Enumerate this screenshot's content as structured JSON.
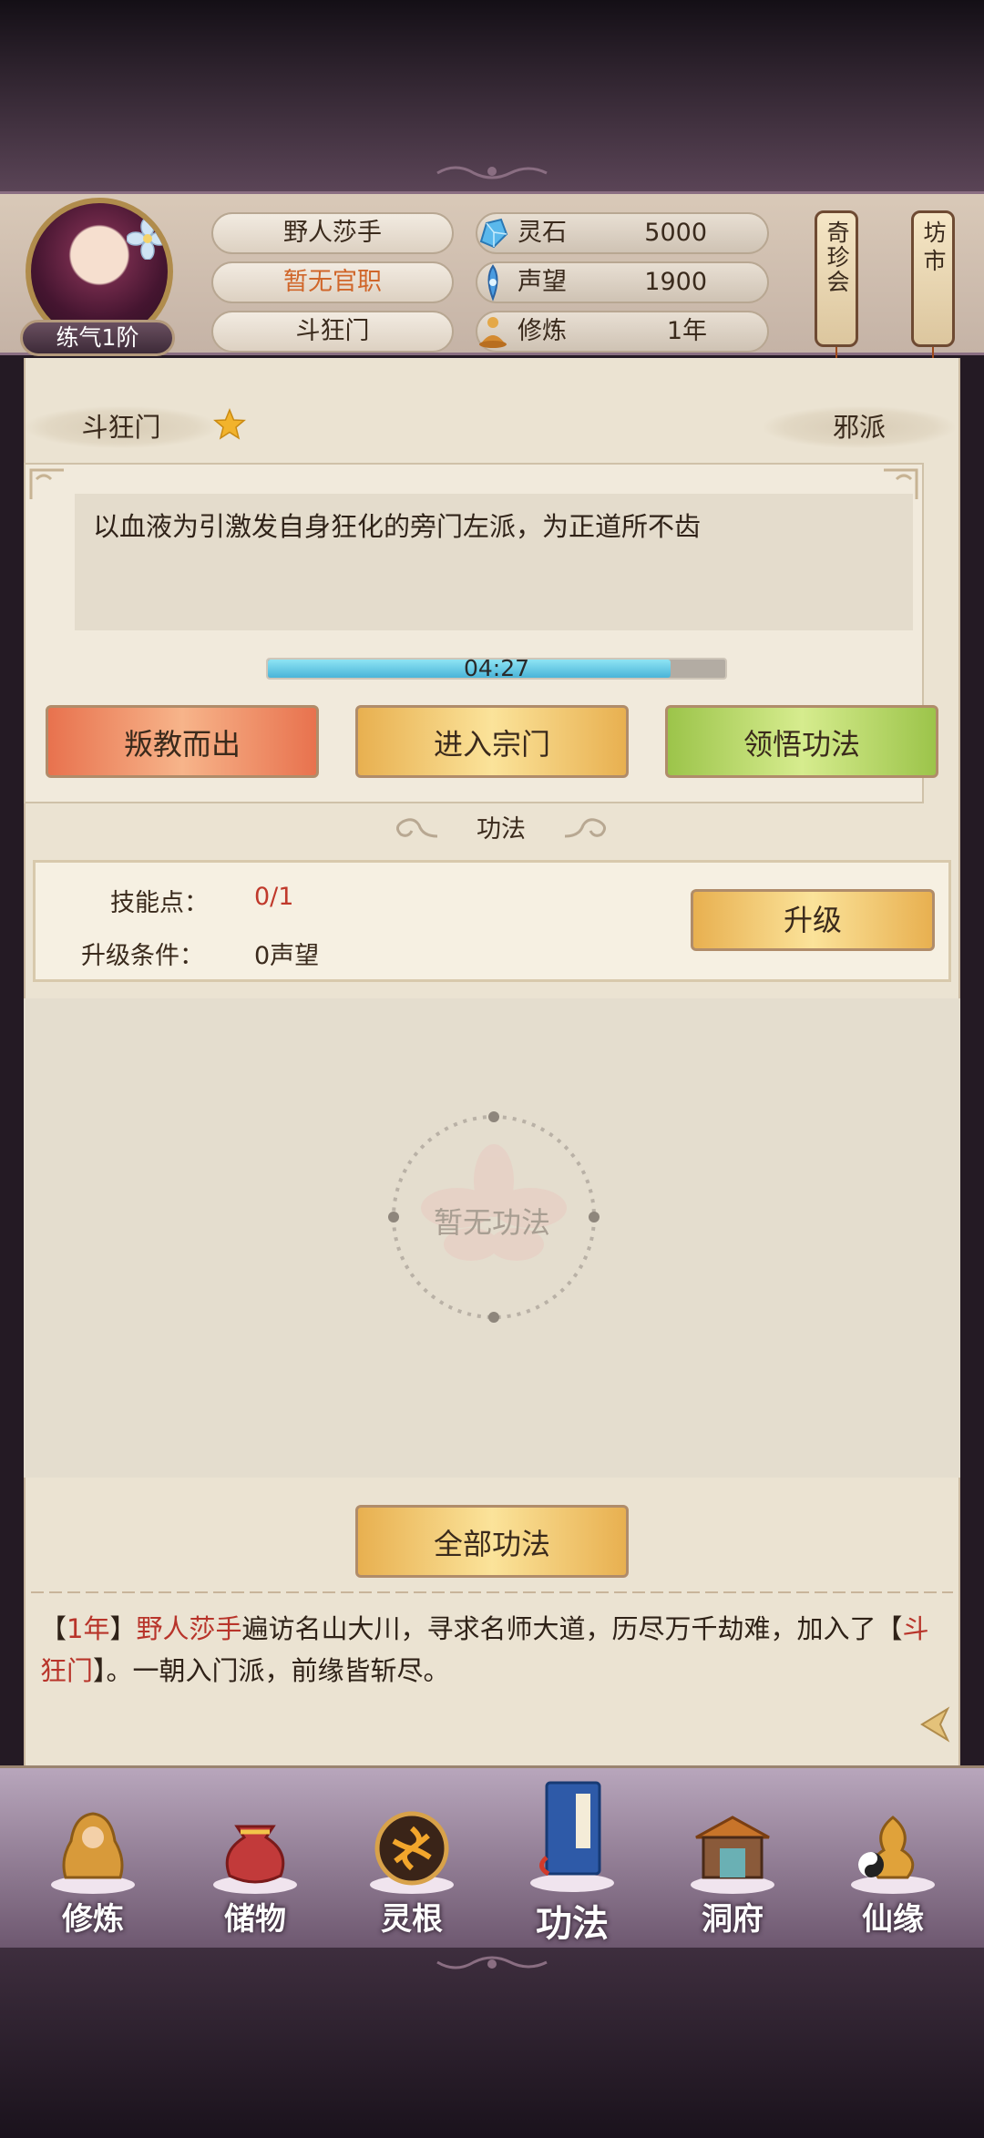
{
  "header": {
    "avatar_realm": "练气1阶",
    "player_name": "野人莎手",
    "official_rank": "暂无官职",
    "sect": "斗狂门",
    "resources": [
      {
        "label": "灵石",
        "value": "5000",
        "icon": "spirit-stone-icon"
      },
      {
        "label": "声望",
        "value": "1900",
        "icon": "prestige-icon"
      },
      {
        "label": "修炼",
        "value": "1年",
        "icon": "meditation-icon"
      }
    ],
    "lanterns": [
      {
        "label": "奇珍会"
      },
      {
        "label": "坊市"
      }
    ]
  },
  "sect_panel": {
    "sect_name": "斗狂门",
    "alignment": "邪派",
    "description": "以血液为引激发自身狂化的旁门左派，为正道所不齿",
    "timer": "04:27",
    "timer_progress": 0.88,
    "buttons": {
      "betray": "叛教而出",
      "enter": "进入宗门",
      "learn": "领悟功法"
    }
  },
  "technique": {
    "section_title": "功法",
    "skill_points_label": "技能点：",
    "skill_points_value": "0/1",
    "upgrade_condition_label": "升级条件：",
    "upgrade_condition_value": "0声望",
    "upgrade_button": "升级",
    "empty_text": "暂无功法",
    "all_button": "全部功法"
  },
  "log": {
    "year": "1年",
    "name": "野人莎手",
    "text1": "遍访名山大川，寻求名师大道，历尽万千劫难，加入了",
    "sect": "斗狂门",
    "text2": "。一朝入门派，前缘皆斩尽。"
  },
  "bottom_nav": [
    {
      "label": "修炼",
      "icon": "cultivation-icon"
    },
    {
      "label": "储物",
      "icon": "storage-bag-icon"
    },
    {
      "label": "灵根",
      "icon": "spirit-root-icon"
    },
    {
      "label": "功法",
      "icon": "technique-book-icon"
    },
    {
      "label": "洞府",
      "icon": "cave-dwelling-icon"
    },
    {
      "label": "仙缘",
      "icon": "immortal-fate-icon"
    }
  ],
  "colors": {
    "accent_orange": "#d0662a",
    "highlight_red": "#b8342a",
    "progress_blue": "#4ab4d8"
  }
}
